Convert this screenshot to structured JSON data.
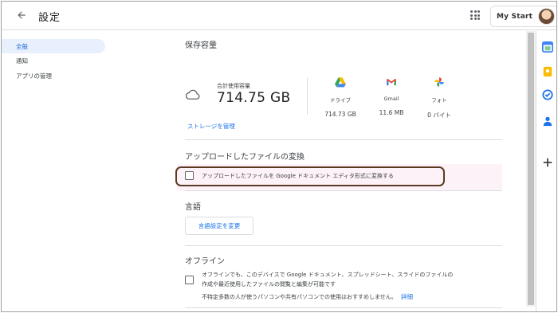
{
  "header": {
    "title": "設定",
    "my_start_label": "My Start"
  },
  "nav": {
    "items": [
      {
        "label": "全般"
      },
      {
        "label": "通知"
      },
      {
        "label": "アプリの管理"
      }
    ]
  },
  "storage": {
    "heading": "保存容量",
    "total_label": "合計使用容量",
    "total_value": "714.75 GB",
    "services": [
      {
        "name": "ドライブ",
        "value": "714.73 GB",
        "icon": "drive-icon"
      },
      {
        "name": "Gmail",
        "value": "11.6 MB",
        "icon": "gmail-icon"
      },
      {
        "name": "フォト",
        "value": "0 バイト",
        "icon": "photos-icon"
      }
    ],
    "manage_link": "ストレージを管理"
  },
  "convert": {
    "heading": "アップロードしたファイルの変換",
    "checkbox_label": "アップロードしたファイルを Google ドキュメント エディタ形式に変換する",
    "checked": false
  },
  "language": {
    "heading": "言語",
    "button_label": "言語設定を変更"
  },
  "offline": {
    "heading": "オフライン",
    "line1": "オフラインでも、このデバイスで Google ドキュメント、スプレッドシート、スライドのファイルの",
    "line2": "作成や最近使用したファイルの閲覧と編集が可能です",
    "line3": "不特定多数の人が使うパソコンや共有パソコンでの使用はおすすめしません。",
    "details_link": "詳細",
    "checked": false
  },
  "colors": {
    "accent": "#1a73e8",
    "nav_active_bg": "#e8f0fe",
    "highlight_border": "#5b3a21"
  }
}
